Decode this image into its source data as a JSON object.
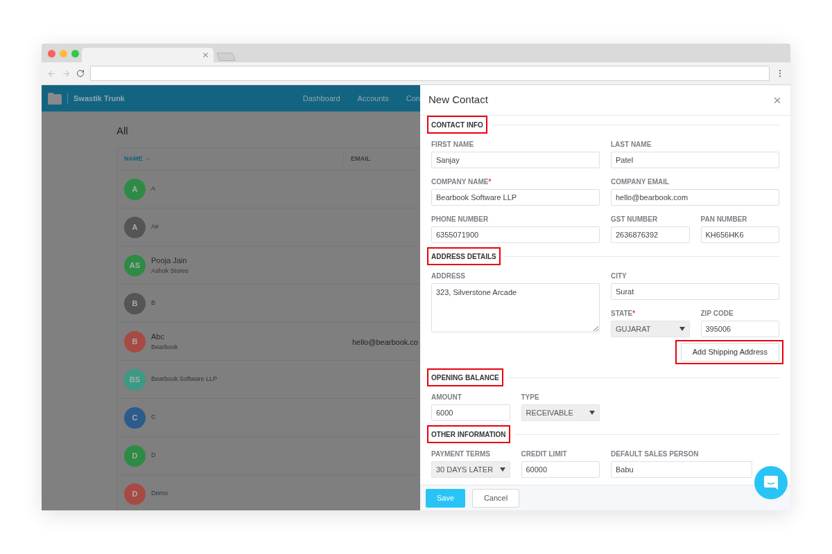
{
  "app": {
    "brand": "Swastik Trunk",
    "nav": [
      "Dashboard",
      "Accounts",
      "Con"
    ]
  },
  "list": {
    "title": "All",
    "columns": [
      {
        "label": "NAME",
        "sorted": true
      },
      {
        "label": "EMAIL",
        "sorted": false
      }
    ],
    "rows": [
      {
        "initials": "A",
        "color": "#2e8b46",
        "name": "A"
      },
      {
        "initials": "A",
        "color": "#555555",
        "name": "Air"
      },
      {
        "initials": "AS",
        "color": "#2e8b46",
        "name": "Pooja Jain",
        "subtitle": "Ashok Stores"
      },
      {
        "initials": "B",
        "color": "#555555",
        "name": "B"
      },
      {
        "initials": "B",
        "color": "#a84a44",
        "name": "Abc",
        "subtitle": "Bearbook",
        "email": "hello@bearbook.co"
      },
      {
        "initials": "BS",
        "color": "#3a9a85",
        "name": "Bearbook Software LLP"
      },
      {
        "initials": "C",
        "color": "#2c5b8e",
        "name": "C"
      },
      {
        "initials": "D",
        "color": "#2e8b46",
        "name": "D"
      },
      {
        "initials": "D",
        "color": "#a84a44",
        "name": "Demo"
      }
    ]
  },
  "panel": {
    "title": "New Contact",
    "sections": [
      {
        "title": "CONTACT INFO",
        "highlighted": true,
        "fields": [
          {
            "label": "FIRST NAME",
            "kind": "text",
            "value": "Sanjay"
          },
          {
            "label": "LAST NAME",
            "kind": "text",
            "value": "Patel"
          },
          {
            "label": "COMPANY NAME",
            "marker": "*",
            "kind": "text",
            "value": "Bearbook Software LLP"
          },
          {
            "label": "COMPANY EMAIL",
            "kind": "text",
            "value": "hello@bearbook.com"
          },
          {
            "label": "PHONE NUMBER",
            "kind": "text",
            "value": "6355071900"
          },
          {
            "label": "GST NUMBER",
            "kind": "text",
            "value": "2636876392"
          },
          {
            "label": "PAN NUMBER",
            "kind": "text",
            "value": "KH656HK6"
          }
        ]
      },
      {
        "title": "ADDRESS DETAILS",
        "highlighted": true,
        "fields": [
          {
            "label": "ADDRESS",
            "kind": "textarea",
            "value": "323, Silverstone Arcade"
          },
          {
            "label": "CITY",
            "kind": "text",
            "value": "Surat"
          },
          {
            "label": "STATE",
            "marker": "*",
            "kind": "select",
            "value": "GUJARAT"
          },
          {
            "label": "ZIP CODE",
            "kind": "text",
            "value": "395006"
          }
        ],
        "button": {
          "label": "Add Shipping Address",
          "highlighted": true
        }
      },
      {
        "title": "OPENING BALANCE",
        "highlighted": true,
        "fields": [
          {
            "label": "AMOUNT",
            "kind": "text",
            "value": "6000"
          },
          {
            "label": "TYPE",
            "kind": "select",
            "value": "RECEIVABLE"
          }
        ]
      },
      {
        "title": "OTHER INFORMATION",
        "highlighted": true,
        "fields": [
          {
            "label": "PAYMENT TERMS",
            "kind": "select",
            "value": "30 DAYS LATER"
          },
          {
            "label": "CREDIT LIMIT",
            "kind": "text",
            "value": "60000"
          },
          {
            "label": "DEFAULT SALES PERSON",
            "kind": "text",
            "value": "Babu"
          }
        ]
      }
    ],
    "footer": {
      "save": "Save",
      "cancel": "Cancel"
    }
  }
}
